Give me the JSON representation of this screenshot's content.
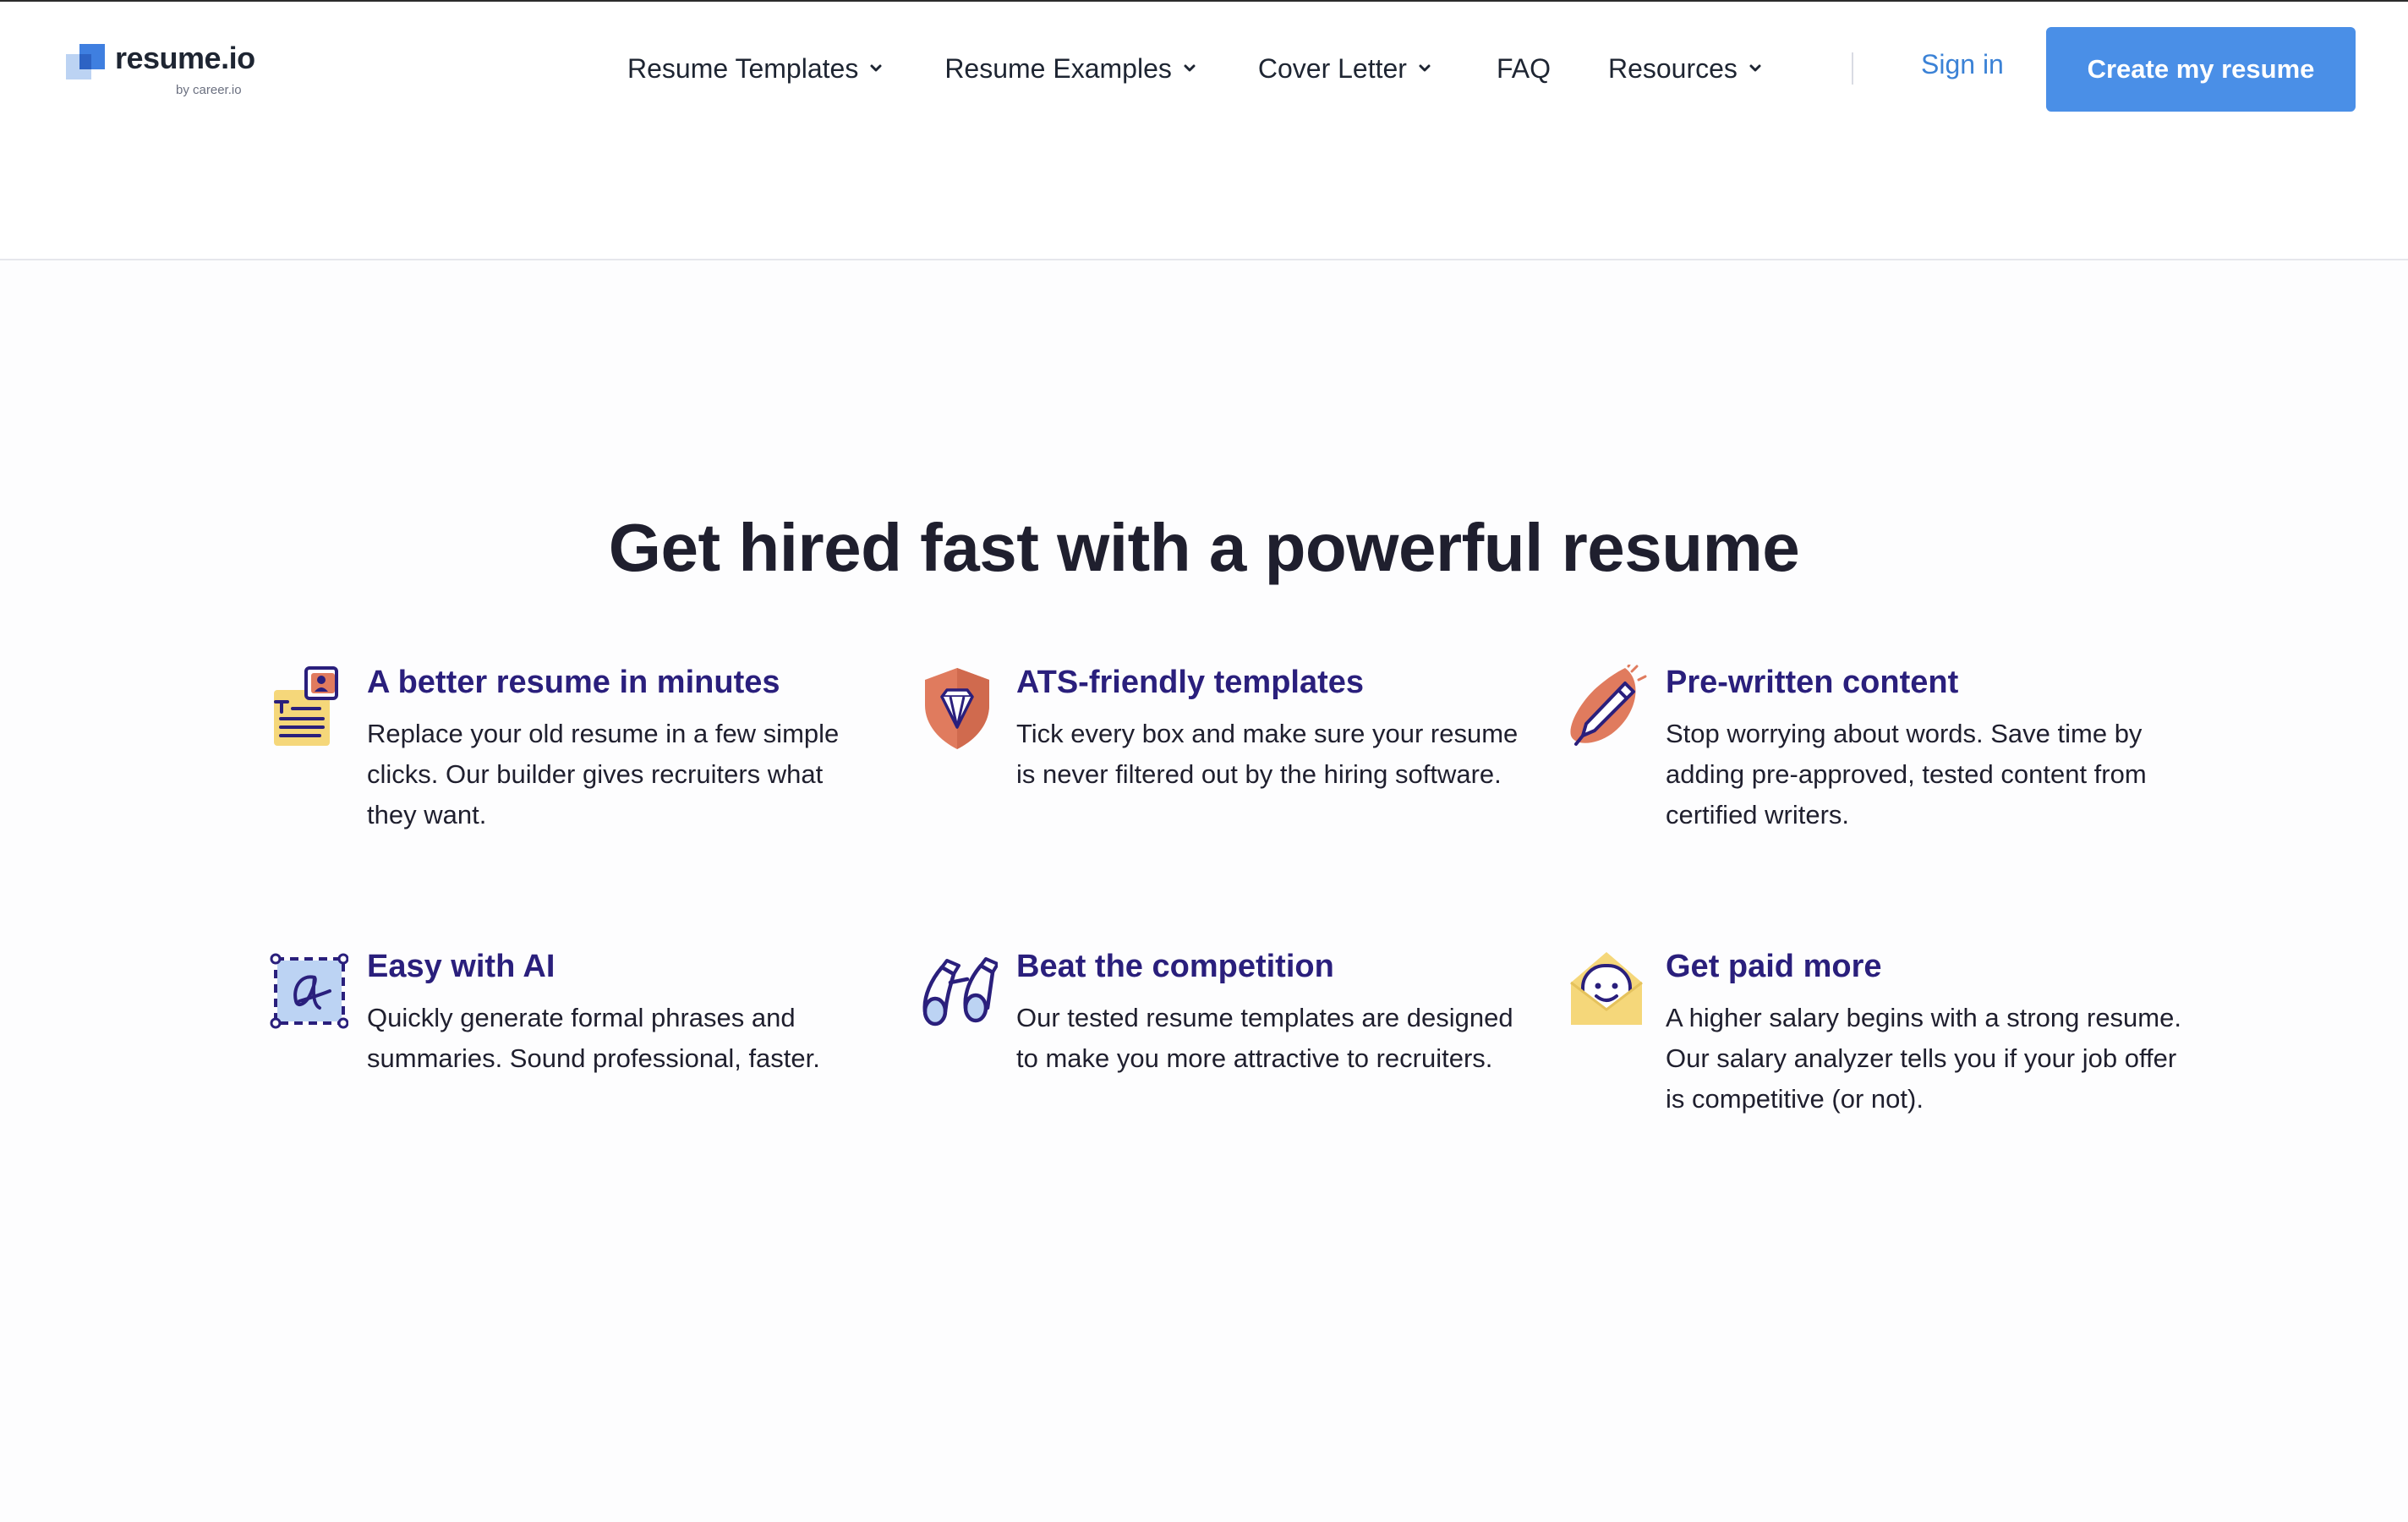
{
  "header": {
    "logo_text": "resume.io",
    "logo_sub": "by career.io",
    "nav": [
      {
        "label": "Resume Templates",
        "has_dropdown": true
      },
      {
        "label": "Resume Examples",
        "has_dropdown": true
      },
      {
        "label": "Cover Letter",
        "has_dropdown": true
      },
      {
        "label": "FAQ",
        "has_dropdown": false
      },
      {
        "label": "Resources",
        "has_dropdown": true
      }
    ],
    "sign_in": "Sign in",
    "cta": "Create my resume"
  },
  "main": {
    "headline": "Get hired fast with a powerful resume",
    "features": [
      {
        "icon": "resume-document-icon",
        "title": "A better resume in minutes",
        "description": "Replace your old resume in a few simple clicks. Our builder gives recruiters what they want."
      },
      {
        "icon": "shield-diamond-icon",
        "title": "ATS-friendly templates",
        "description": "Tick every box and make sure your resume is never filtered out by the hiring software."
      },
      {
        "icon": "pen-icon",
        "title": "Pre-written content",
        "description": "Stop worrying about words. Save time by adding pre-approved, tested content from certified writers."
      },
      {
        "icon": "ai-text-icon",
        "title": "Easy with AI",
        "description": "Quickly generate formal phrases and summaries. Sound professional, faster."
      },
      {
        "icon": "binoculars-icon",
        "title": "Beat the competition",
        "description": "Our tested resume templates are designed to make you more attractive to recruiters."
      },
      {
        "icon": "smiley-envelope-icon",
        "title": "Get paid more",
        "description": "A higher salary begins with a strong resume. Our salary analyzer tells you if your job offer is competitive (or not)."
      }
    ]
  },
  "colors": {
    "accent_blue": "#4a8fe7",
    "link_blue": "#3b82d6",
    "feature_title": "#2a1f7c",
    "icon_orange": "#e07b5e",
    "icon_yellow": "#f5d77a",
    "icon_light_blue": "#bcd3f3"
  }
}
